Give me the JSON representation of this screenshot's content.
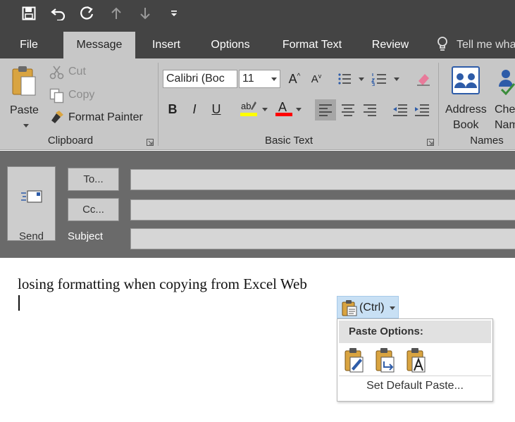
{
  "qat": {
    "icons": [
      "save-icon",
      "undo-icon",
      "redo-icon",
      "up-arrow-icon",
      "down-arrow-icon",
      "customize-qat-icon"
    ]
  },
  "tabs": [
    "File",
    "Message",
    "Insert",
    "Options",
    "Format Text",
    "Review"
  ],
  "active_tab": "Message",
  "tell_me": "Tell me wha",
  "clipboard": {
    "paste_label": "Paste",
    "cut_label": "Cut",
    "copy_label": "Copy",
    "format_painter_label": "Format Painter",
    "group_label": "Clipboard"
  },
  "basic_text": {
    "font_name": "Calibri (Boc",
    "font_size": "11",
    "bold": "B",
    "italic": "I",
    "underline": "U",
    "highlight_color": "#ffff00",
    "font_color": "#ff0000",
    "group_label": "Basic Text"
  },
  "names": {
    "address_book_line1": "Address",
    "address_book_line2": "Book",
    "check_names_line1": "Che",
    "check_names_line2": "Nam",
    "group_label": "Names"
  },
  "compose": {
    "send_label": "Send",
    "to_label": "To...",
    "cc_label": "Cc...",
    "subject_label": "Subject",
    "to_value": "",
    "cc_value": "",
    "subject_value": ""
  },
  "body": {
    "text": "losing formatting when copying from Excel Web"
  },
  "paste_options": {
    "trigger_label": "(Ctrl)",
    "header": "Paste Options:",
    "options": [
      "keep-source-formatting-icon",
      "merge-formatting-icon",
      "keep-text-only-icon"
    ],
    "set_default_label": "Set Default Paste..."
  },
  "colors": {
    "chrome_dark": "#444444",
    "ribbon": "#c7c7c7",
    "compose_header": "#6a6a6a",
    "paste_trigger": "#c8e0f4"
  }
}
